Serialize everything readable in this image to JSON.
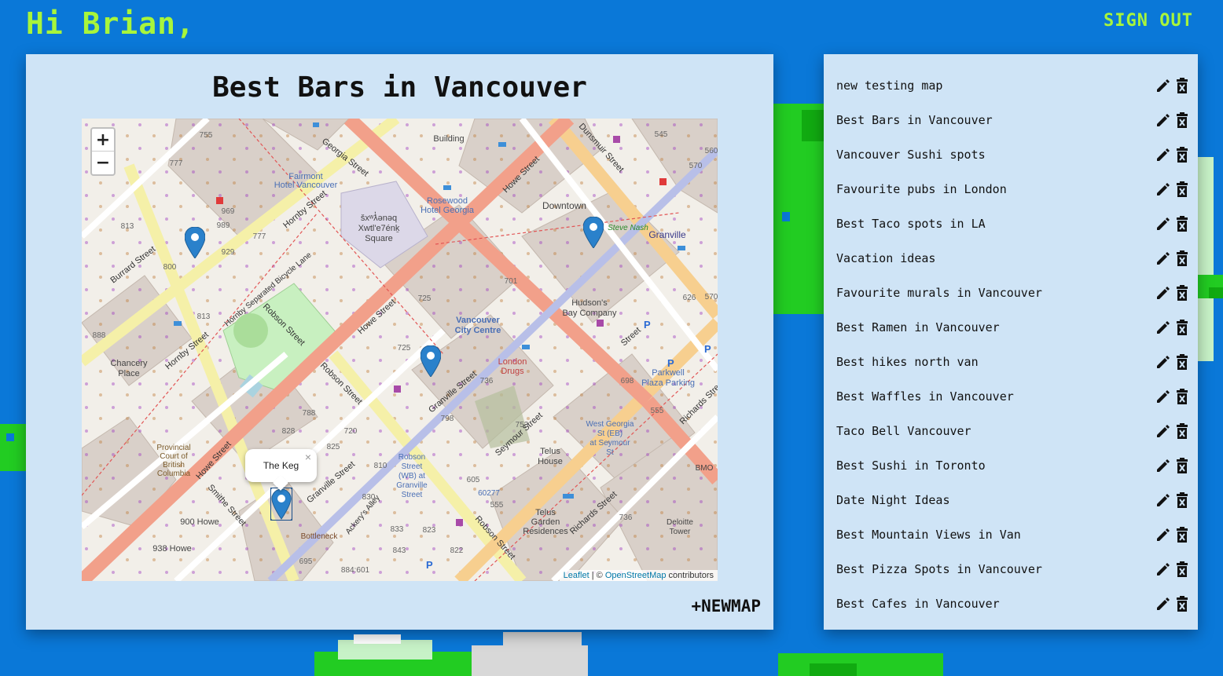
{
  "header": {
    "greeting": "Hi Brian,",
    "sign_out": "SIGN OUT"
  },
  "map": {
    "title": "Best Bars in Vancouver",
    "zoom_in": "+",
    "zoom_out": "−",
    "popup_text": "The Keg",
    "popup_close": "×",
    "attribution_leaflet": "Leaflet",
    "attribution_sep": " | © ",
    "attribution_osm": "OpenStreetMap",
    "attribution_tail": " contributors",
    "labels": {
      "georgia_street": "Georgia Street",
      "dunsmuir_street": "Dunsmuir Street",
      "hornby_street": "Hornby Street",
      "burrard_street": "Burrard Street",
      "howe_street": "Howe Street",
      "robson_street": "Robson Street",
      "granville_street": "Granville Street",
      "seymour_street": "Seymour Street",
      "richards_street": "Richards Street",
      "smithe_street": "Smithe Street",
      "fairmont": "Fairmont Hotel Vancouver",
      "rosewood": "Rosewood Hotel Georgia",
      "square": "šxʷƛ̓ənəq Xwtl'e7énḵ Square",
      "downtown": "Downtown",
      "granville": "Granville",
      "hudsons_bay": "Hudson's Bay Company",
      "city_centre": "Vancouver City Centre",
      "london_drugs": "London Drugs",
      "chancery": "Chancery Place",
      "court": "Provincial Court of British Columbia",
      "telus_house": "Telus House",
      "telus_garden": "Telus Garden Residences",
      "robson_wb": "Robson Street (WB) at Granville Street",
      "west_georgia": "West Georgia St (EB) at Seymour St",
      "parkwell": "Parkwell Plaza Parking",
      "bottleneck": "Bottleneck",
      "ackerys": "Ackery's Alley",
      "steve_nash": "Steve Nash",
      "deloitte": "Deloitte Tower",
      "bmo": "BMO",
      "howe_900": "900 Howe",
      "howe_938": "938 Howe",
      "hornby_lane": "Hornby Separated Bicycle Lane",
      "building": "Building",
      "n755": "755",
      "n777": "777",
      "n969": "969",
      "n989": "989",
      "n813": "813",
      "n800": "800",
      "n929": "929",
      "n888": "888",
      "n725": "725",
      "n701": "701",
      "n626": "626",
      "n570": "570",
      "n545": "545",
      "n560": "560",
      "n736": "736",
      "n698": "698",
      "n555": "555",
      "n753": "753",
      "n798": "798",
      "n605": "605",
      "n788": "788",
      "n828": "828",
      "n825": "825",
      "n810": "810",
      "n830": "830",
      "n833": "833",
      "n843": "843",
      "n822": "822",
      "n695": "695",
      "n884": "884:601",
      "n60277": "60277"
    }
  },
  "new_map": "+NEWMAP",
  "maps": [
    "new testing map",
    "Best Bars in Vancouver",
    "Vancouver Sushi spots",
    "Favourite pubs in London",
    "Best Taco spots in LA",
    "Vacation ideas",
    "Favourite murals in Vancouver",
    "Best Ramen in Vancouver",
    "Best hikes north van",
    "Best Waffles in Vancouver",
    "Taco Bell Vancouver",
    "Best Sushi in Toronto",
    "Date Night Ideas",
    "Best Mountain Views in Van",
    "Best Pizza Spots in Vancouver",
    "Best Cafes in Vancouver"
  ],
  "icons": {
    "edit": "pencil-icon",
    "delete": "trash-icon",
    "marker": "map-marker-icon"
  },
  "colors": {
    "background": "#0a78d8",
    "accent": "#a8f53b",
    "panel": "#cfe4f6",
    "marker": "#2a81cb",
    "primary_road": "#f2a08a",
    "secondary_road": "#f7cf8f",
    "tertiary_road": "#f5f0a8"
  }
}
